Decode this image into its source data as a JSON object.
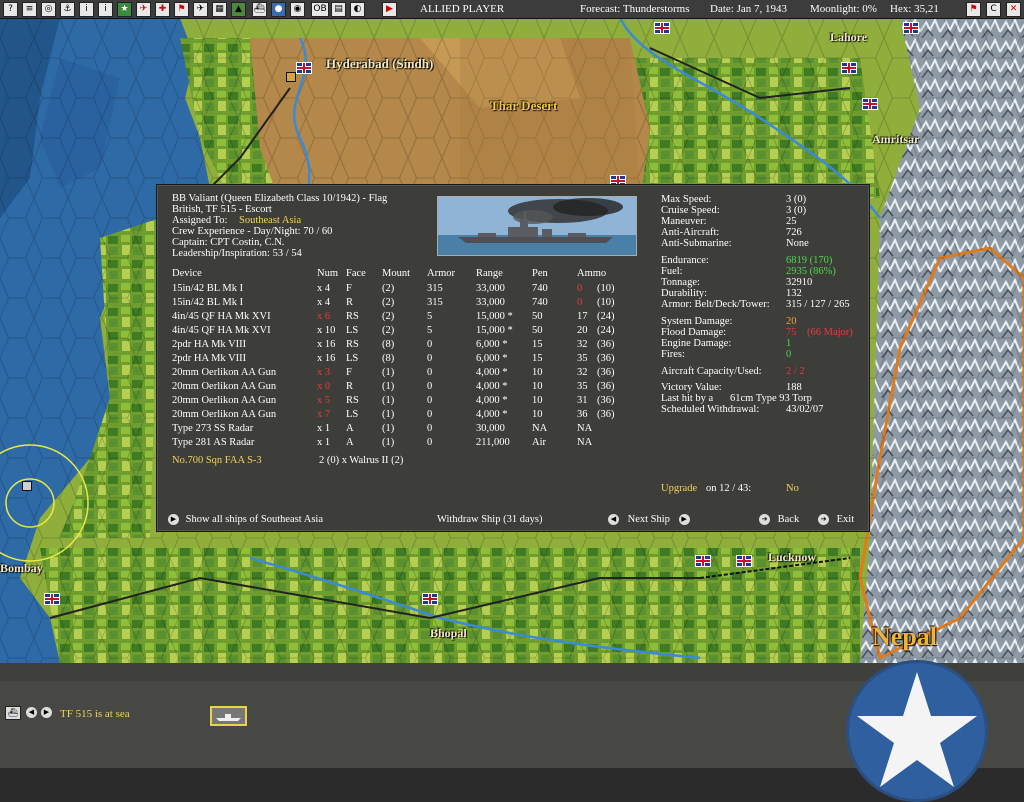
{
  "topbar": {
    "player": "ALLIED PLAYER",
    "forecast": "Forecast: Thunderstorms",
    "date": "Date: Jan 7, 1943",
    "moonlight": "Moonlight: 0%",
    "hex": "Hex: 35,21",
    "icons": [
      "help-icon",
      "document-icon",
      "network-icon",
      "ship-icon",
      "info-icon",
      "star-icon",
      "plane-icon",
      "airgroup-icon",
      "flag-icon",
      "aircraft-icon",
      "map-icon",
      "ships-icon",
      "globe-icon",
      "intel-icon",
      "ob-icon",
      "report-icon",
      "circle-icon",
      "play-icon"
    ],
    "ob_label": "OB",
    "right_icons": [
      "flag-icon",
      "c-icon",
      "close-icon"
    ],
    "c_label": "C"
  },
  "map_labels": {
    "hyderabad": "Hyderabad (Sindh)",
    "thar": "Thar Desert",
    "lahore": "Lahore",
    "amritsar": "Amritsar",
    "bombay": "Bombay",
    "bhopal": "Bhopal",
    "lucknow": "Lucknow",
    "nepal": "Nepal"
  },
  "ship": {
    "title": "BB Valiant (Queen Elizabeth Class 10/1942) - Flag",
    "force": "British, TF 515 - Escort",
    "assigned_label": "Assigned To:",
    "assigned_value": "Southeast Asia",
    "crew": "Crew Experience - Day/Night: 70 / 60",
    "captain": "Captain: CPT Costin, C.N.",
    "leadership": "Leadership/Inspiration: 53 / 54"
  },
  "device_table": {
    "headers": [
      "Device",
      "Num",
      "Face",
      "Mount",
      "Armor",
      "Range",
      "Pen",
      "Ammo"
    ],
    "rows": [
      {
        "device": "15in/42 BL Mk I",
        "num": "x 4",
        "face": "F",
        "mount": "(2)",
        "armor": "315",
        "range": "33,000",
        "pen": "740",
        "ammo_cur": "0",
        "ammo_max": "(10)",
        "num_red": false,
        "ammo_red": true
      },
      {
        "device": "15in/42 BL Mk I",
        "num": "x 4",
        "face": "R",
        "mount": "(2)",
        "armor": "315",
        "range": "33,000",
        "pen": "740",
        "ammo_cur": "0",
        "ammo_max": "(10)",
        "num_red": false,
        "ammo_red": true
      },
      {
        "device": "4in/45 QF HA Mk XVI",
        "num": "x 6",
        "face": "RS",
        "mount": "(2)",
        "armor": "5",
        "range": "15,000 *",
        "pen": "50",
        "ammo_cur": "17",
        "ammo_max": "(24)",
        "num_red": true,
        "ammo_red": false
      },
      {
        "device": "4in/45 QF HA Mk XVI",
        "num": "x 10",
        "face": "LS",
        "mount": "(2)",
        "armor": "5",
        "range": "15,000 *",
        "pen": "50",
        "ammo_cur": "20",
        "ammo_max": "(24)",
        "num_red": false,
        "ammo_red": false
      },
      {
        "device": "2pdr HA Mk VIII",
        "num": "x 16",
        "face": "RS",
        "mount": "(8)",
        "armor": "0",
        "range": "6,000 *",
        "pen": "15",
        "ammo_cur": "32",
        "ammo_max": "(36)",
        "num_red": false,
        "ammo_red": false
      },
      {
        "device": "2pdr HA Mk VIII",
        "num": "x 16",
        "face": "LS",
        "mount": "(8)",
        "armor": "0",
        "range": "6,000 *",
        "pen": "15",
        "ammo_cur": "35",
        "ammo_max": "(36)",
        "num_red": false,
        "ammo_red": false
      },
      {
        "device": "20mm Oerlikon AA Gun",
        "num": "x 3",
        "face": "F",
        "mount": "(1)",
        "armor": "0",
        "range": "4,000 *",
        "pen": "10",
        "ammo_cur": "32",
        "ammo_max": "(36)",
        "num_red": true,
        "ammo_red": false
      },
      {
        "device": "20mm Oerlikon AA Gun",
        "num": "x 0",
        "face": "R",
        "mount": "(1)",
        "armor": "0",
        "range": "4,000 *",
        "pen": "10",
        "ammo_cur": "35",
        "ammo_max": "(36)",
        "num_red": true,
        "ammo_red": false
      },
      {
        "device": "20mm Oerlikon AA Gun",
        "num": "x 5",
        "face": "RS",
        "mount": "(1)",
        "armor": "0",
        "range": "4,000 *",
        "pen": "10",
        "ammo_cur": "31",
        "ammo_max": "(36)",
        "num_red": true,
        "ammo_red": false
      },
      {
        "device": "20mm Oerlikon AA Gun",
        "num": "x 7",
        "face": "LS",
        "mount": "(1)",
        "armor": "0",
        "range": "4,000 *",
        "pen": "10",
        "ammo_cur": "36",
        "ammo_max": "(36)",
        "num_red": true,
        "ammo_red": false
      },
      {
        "device": "Type 273 SS Radar",
        "num": "x 1",
        "face": "A",
        "mount": "(1)",
        "armor": "0",
        "range": "30,000",
        "pen": "NA",
        "ammo_cur": "NA",
        "ammo_max": "",
        "num_red": false,
        "ammo_red": false
      },
      {
        "device": "Type 281 AS Radar",
        "num": "x 1",
        "face": "A",
        "mount": "(1)",
        "armor": "0",
        "range": "211,000",
        "pen": "Air",
        "ammo_cur": "NA",
        "ammo_max": "",
        "num_red": false,
        "ammo_red": false
      }
    ]
  },
  "air_group": {
    "name": "No.700 Sqn FAA S-3",
    "aircraft": "2 (0) x Walrus II (2)"
  },
  "stats": [
    {
      "label": "Max Speed:",
      "value": "3 (0)",
      "color": "white"
    },
    {
      "label": "Cruise Speed:",
      "value": "3 (0)",
      "color": "white"
    },
    {
      "label": "Maneuver:",
      "value": "25",
      "color": "white"
    },
    {
      "label": "Anti-Aircraft:",
      "value": "726",
      "color": "white"
    },
    {
      "label": "Anti-Submarine:",
      "value": "None",
      "color": "white"
    },
    {
      "label": "Endurance:",
      "value": "6819 (170)",
      "color": "green"
    },
    {
      "label": "Fuel:",
      "value": "2935 (86%)",
      "color": "green"
    },
    {
      "label": "Tonnage:",
      "value": "32910",
      "color": "white"
    },
    {
      "label": "Durability:",
      "value": "132",
      "color": "white"
    },
    {
      "label": "Armor: Belt/Deck/Tower:",
      "value": "315 / 127 / 265",
      "color": "white"
    },
    {
      "label": "System Damage:",
      "value": "20",
      "color": "orange"
    },
    {
      "label": "Flood Damage:",
      "value": "75",
      "value2": "(66 Major)",
      "color": "red"
    },
    {
      "label": "Engine Damage:",
      "value": "1",
      "color": "green"
    },
    {
      "label": "Fires:",
      "value": "0",
      "color": "green"
    },
    {
      "label": "Aircraft Capacity/Used:",
      "value": "2 / 2",
      "color": "red"
    },
    {
      "label": "Victory Value:",
      "value": "188",
      "color": "white"
    },
    {
      "label": "Last hit by a",
      "value": "61cm Type 93 Torp",
      "color": "white"
    },
    {
      "label": "Scheduled Withdrawal:",
      "value": "43/02/07",
      "color": "white"
    }
  ],
  "upgrade": {
    "label": "Upgrade",
    "date": "on 12 / 43:",
    "value": "No"
  },
  "footer": {
    "show_all": "Show all ships of Southeast Asia",
    "withdraw": "Withdraw Ship (31 days)",
    "next": "Next Ship",
    "back": "Back",
    "exit": "Exit"
  },
  "bottombar": {
    "status": "TF 515 is at sea"
  },
  "colors": {
    "highlight_yellow": "#f2d35a",
    "good_green": "#4cd94c",
    "bad_red": "#e83a3a",
    "warn_orange": "#f2a23a",
    "ocean": "#2e6aa6",
    "panel": "#3d3d3a"
  }
}
